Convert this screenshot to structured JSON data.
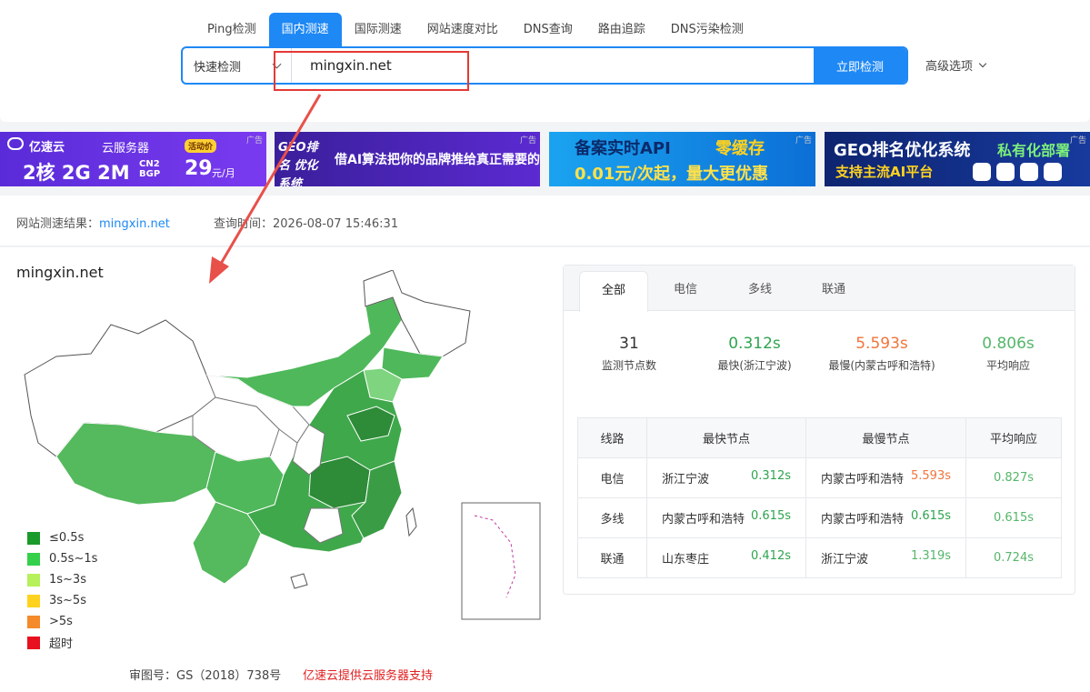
{
  "tabs": [
    "Ping检测",
    "国内测速",
    "国际测速",
    "网站速度对比",
    "DNS查询",
    "路由追踪",
    "DNS污染检测"
  ],
  "search": {
    "mode": "快速检测",
    "value": "mingxin.net",
    "button": "立即检测",
    "advanced": "高级选项"
  },
  "ads": {
    "ad1": {
      "brand": "亿速云",
      "product": "云服务器",
      "badge": "活动价",
      "spec": "2核 2G 2M",
      "spec_small": "CN2 BGP",
      "price": "29",
      "unit": "元/月",
      "tag": "广告"
    },
    "ad2": {
      "left": "GEO排名 优化系统",
      "text": "借AI算法把你的品牌推给真正需要的客户",
      "tag": "广告"
    },
    "ad3": {
      "line1": "备案实时API",
      "line1b": "零缓存",
      "line2": "0.01元/次起，量大更优惠",
      "tag": "广告"
    },
    "ad4": {
      "line1": "GEO排名优化系统",
      "line1b": "私有化部署",
      "line2": "支持主流AI平台",
      "tag": "广告"
    }
  },
  "result": {
    "label": "网站测速结果：",
    "domain": "mingxin.net",
    "time_label": "查询时间：",
    "time": "2026-08-07 15:46:31"
  },
  "map": {
    "title": "mingxin.net",
    "legend": [
      {
        "label": "≤0.5s",
        "color": "#1a9a2a"
      },
      {
        "label": "0.5s~1s",
        "color": "#35d04a"
      },
      {
        "label": "1s~3s",
        "color": "#b6f05a"
      },
      {
        "label": "3s~5s",
        "color": "#ffd21f"
      },
      {
        "label": ">5s",
        "color": "#f58a2a"
      },
      {
        "label": "超时",
        "color": "#e8101e"
      }
    ],
    "approval": "审图号：GS（2018）738号",
    "sponsor": "亿速云提供云服务器支持"
  },
  "card": {
    "tabs": [
      "全部",
      "电信",
      "多线",
      "联通"
    ],
    "stats": [
      {
        "value": "31",
        "desc": "监测节点数",
        "color": "#333333"
      },
      {
        "value": "0.312s",
        "desc": "最快(浙江宁波)",
        "color": "#2ea44f"
      },
      {
        "value": "5.593s",
        "desc": "最慢(内蒙古呼和浩特)",
        "color": "#f0743b"
      },
      {
        "value": "0.806s",
        "desc": "平均响应",
        "color": "#55b66a"
      }
    ],
    "headers": [
      "线路",
      "最快节点",
      "最慢节点",
      "平均响应"
    ],
    "rows": [
      {
        "line": "电信",
        "fast_node": "浙江宁波",
        "fast_time": "0.312s",
        "slow_node": "内蒙古呼和浩特",
        "slow_time": "5.593s",
        "avg": "0.827s"
      },
      {
        "line": "多线",
        "fast_node": "内蒙古呼和浩特",
        "fast_time": "0.615s",
        "slow_node": "内蒙古呼和浩特",
        "slow_time": "0.615s",
        "avg": "0.615s"
      },
      {
        "line": "联通",
        "fast_node": "山东枣庄",
        "fast_time": "0.412s",
        "slow_node": "浙江宁波",
        "slow_time": "1.319s",
        "avg": "0.724s"
      }
    ]
  }
}
